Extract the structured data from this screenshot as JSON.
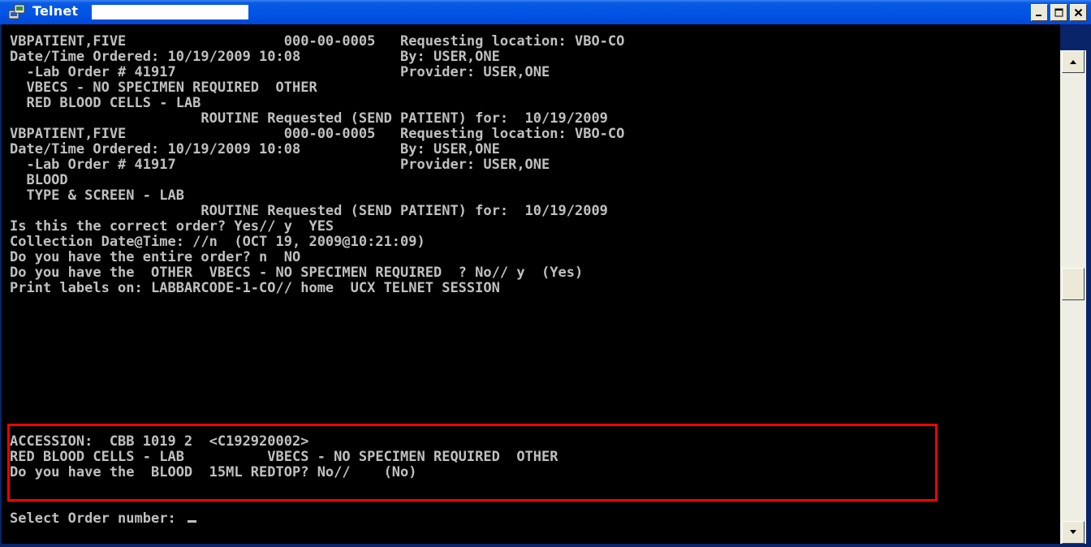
{
  "window": {
    "title": "Telnet",
    "controls": [
      "minimize",
      "maximize",
      "close"
    ]
  },
  "terminal": {
    "lines": [
      "VBPATIENT,FIVE                   000-00-0005   Requesting location: VBO-CO",
      "Date/Time Ordered: 10/19/2009 10:08            By: USER,ONE",
      "  -Lab Order # 41917                           Provider: USER,ONE",
      "  VBECS - NO SPECIMEN REQUIRED  OTHER",
      "  RED BLOOD CELLS - LAB",
      "                       ROUTINE Requested (SEND PATIENT) for:  10/19/2009",
      "VBPATIENT,FIVE                   000-00-0005   Requesting location: VBO-CO",
      "Date/Time Ordered: 10/19/2009 10:08            By: USER,ONE",
      "  -Lab Order # 41917                           Provider: USER,ONE",
      "  BLOOD",
      "  TYPE & SCREEN - LAB",
      "                       ROUTINE Requested (SEND PATIENT) for:  10/19/2009",
      "Is this the correct order? Yes// y  YES",
      "Collection Date@Time: //n  (OCT 19, 2009@10:21:09)",
      "Do you have the entire order? n  NO",
      "Do you have the  OTHER  VBECS - NO SPECIMEN REQUIRED  ? No// y  (Yes)",
      "Print labels on: LABBARCODE-1-CO// home  UCX TELNET SESSION",
      "",
      "",
      "ACCESSION:  CBB 1019 2  <C192920002>",
      "RED BLOOD CELLS - LAB          VBECS - NO SPECIMEN REQUIRED  OTHER",
      "Do you have the  BLOOD  15ML REDTOP? No//    (No)",
      "",
      "Select Order number: "
    ]
  },
  "colors": {
    "terminal_bg": "#000000",
    "terminal_fg": "#c0c0c0",
    "highlight": "#ff0000",
    "titlebar": "#0055e5"
  }
}
